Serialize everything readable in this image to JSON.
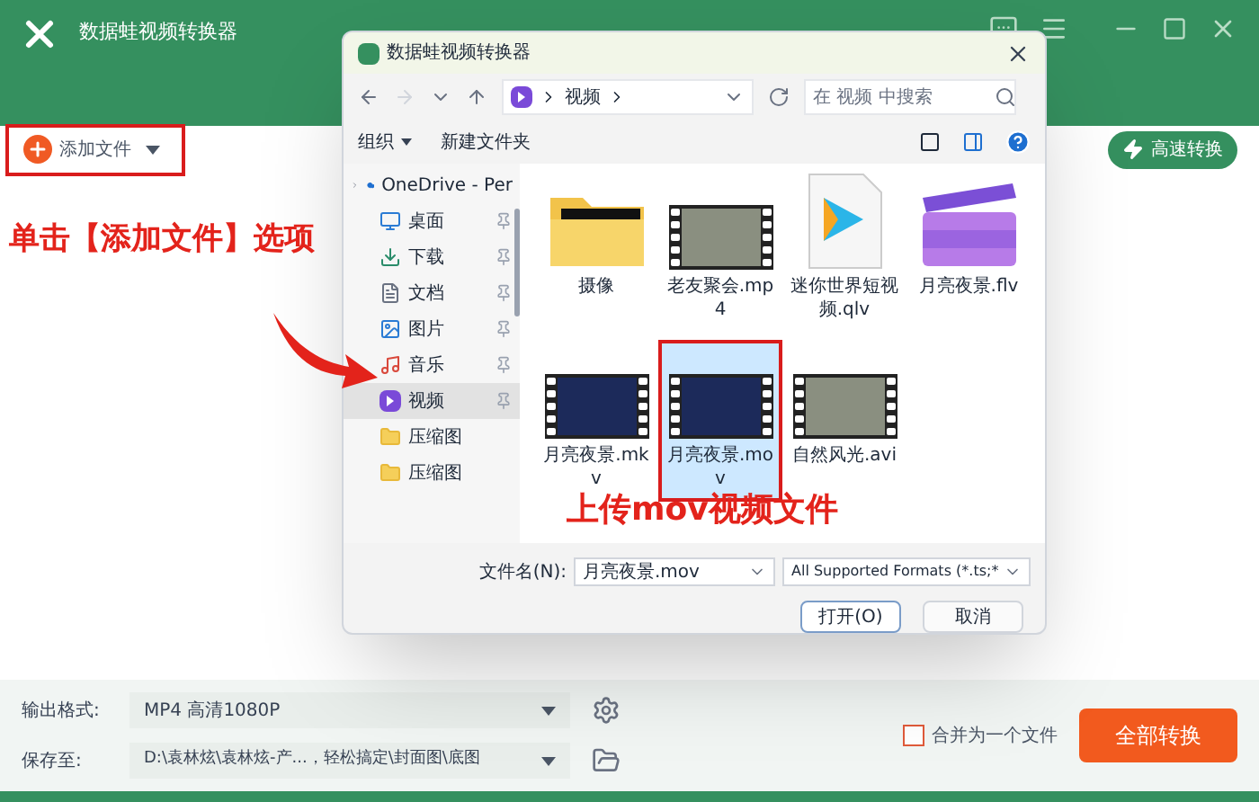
{
  "app": {
    "title": "数据蛙视频转换器"
  },
  "toolbar": {
    "add_file": "添加文件",
    "fast_convert": "高速转换"
  },
  "dialog": {
    "title": "数据蛙视频转换器",
    "address": "视频",
    "search": {
      "placeholder": "在 视频 中搜索"
    },
    "commands": [
      "组织",
      "新建文件夹"
    ],
    "sidebar": [
      {
        "label": "OneDrive - Per",
        "kind": "cloud",
        "pinned": false,
        "selected": false
      },
      {
        "label": "桌面",
        "kind": "desktop",
        "pinned": true,
        "selected": false
      },
      {
        "label": "下载",
        "kind": "download",
        "pinned": true,
        "selected": false
      },
      {
        "label": "文档",
        "kind": "document",
        "pinned": true,
        "selected": false
      },
      {
        "label": "图片",
        "kind": "picture",
        "pinned": true,
        "selected": false
      },
      {
        "label": "音乐",
        "kind": "music",
        "pinned": true,
        "selected": false
      },
      {
        "label": "视频",
        "kind": "video",
        "pinned": true,
        "selected": true
      },
      {
        "label": "压缩图",
        "kind": "folder",
        "pinned": false,
        "selected": false
      },
      {
        "label": "压缩图",
        "kind": "folder",
        "pinned": false,
        "selected": false
      }
    ],
    "files": [
      {
        "name": "摄像",
        "kind": "folder",
        "selected": false
      },
      {
        "name": "老友聚会.mp4",
        "kind": "video",
        "selected": false
      },
      {
        "name": "迷你世界短视频.qlv",
        "kind": "qlv",
        "selected": false
      },
      {
        "name": "月亮夜景.flv",
        "kind": "clapper",
        "selected": false
      },
      {
        "name": "月亮夜景.mkv",
        "kind": "video",
        "selected": false
      },
      {
        "name": "月亮夜景.mov",
        "kind": "video",
        "selected": true
      },
      {
        "name": "自然风光.avi",
        "kind": "video",
        "selected": false
      }
    ],
    "filename_label": "文件名(N):",
    "filename": "月亮夜景.mov",
    "filter": "All Supported Formats (*.ts;*",
    "open": "打开(O)",
    "cancel": "取消"
  },
  "annotations": {
    "step1": "单击【添加文件】选项",
    "step2": "上传mov视频文件"
  },
  "bottom": {
    "format_label": "输出格式:",
    "format": "MP4 高清1080P",
    "save_label": "保存至:",
    "save_path": "D:\\袁林炫\\袁林炫-产...，轻松搞定\\封面图\\底图",
    "merge": {
      "label": "合并为一个文件",
      "checked": false
    },
    "convert_all": "全部转换"
  }
}
